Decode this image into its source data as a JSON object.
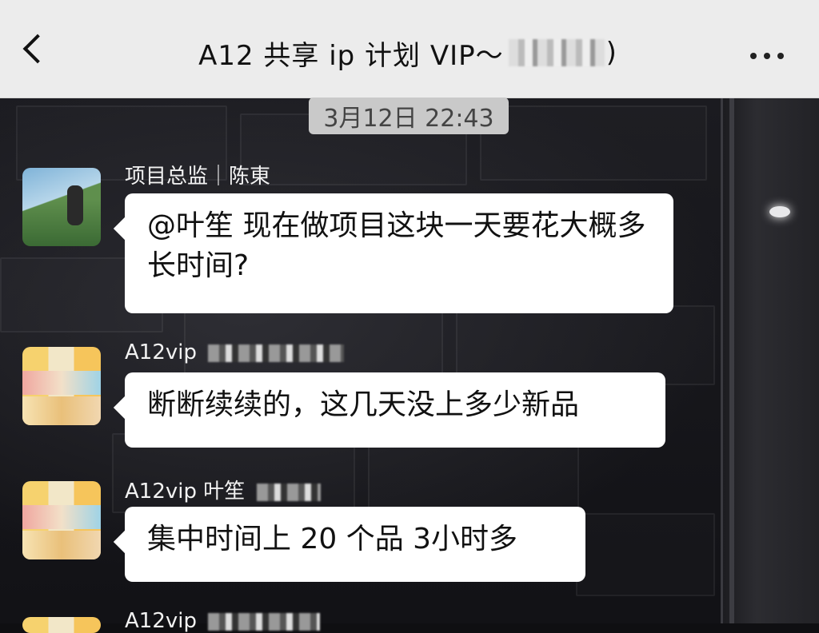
{
  "header": {
    "title": "A12 共享 ip 计划 VIP～",
    "title_tail": ")",
    "back_icon": "chevron-left-icon",
    "more_icon": "more-horizontal-icon"
  },
  "timestamp": "3月12日 22:43",
  "messages": [
    {
      "sender": "项目总监｜陈東",
      "text": "@叶笙 现在做项目这块一天要花大概多长时间?"
    },
    {
      "sender": "A12vip",
      "text": "断断续续的，这几天没上多少新品"
    },
    {
      "sender": "A12vip 叶笙",
      "text": "集中时间上 20 个品 3小时多"
    },
    {
      "sender": "A12vip"
    }
  ]
}
